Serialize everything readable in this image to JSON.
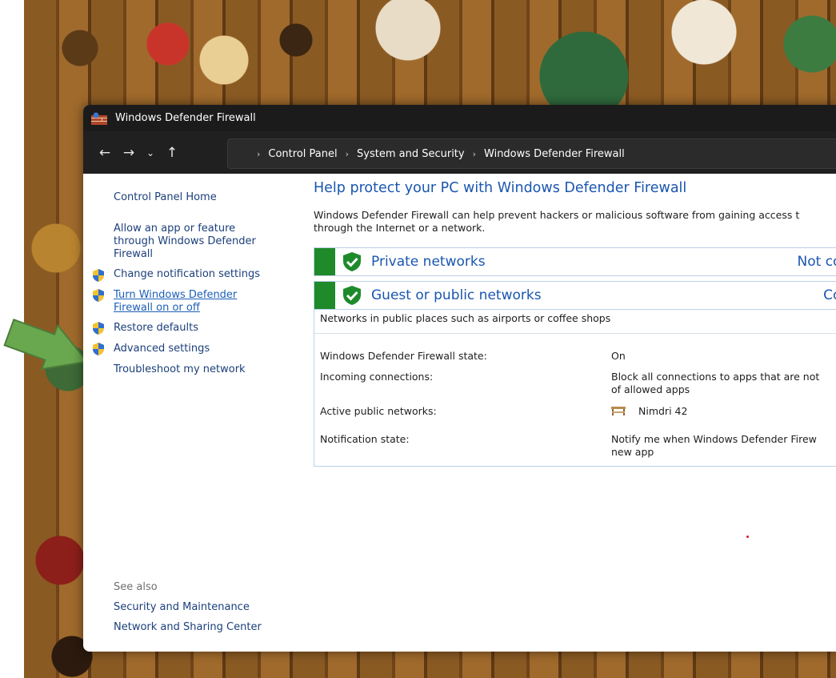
{
  "window": {
    "title": "Windows Defender Firewall",
    "address": {
      "crumbs": [
        "Control Panel",
        "System and Security",
        "Windows Defender Firewall"
      ]
    }
  },
  "sidebar": {
    "home": "Control Panel Home",
    "allow_app_line1": "Allow an app or feature",
    "allow_app_line2": "through Windows Defender",
    "allow_app_line3": "Firewall",
    "change_notifications": "Change notification settings",
    "turn_on_off_line1": "Turn Windows Defender",
    "turn_on_off_line2": "Firewall on or off",
    "restore_defaults": "Restore defaults",
    "advanced_settings": "Advanced settings",
    "troubleshoot": "Troubleshoot my network",
    "see_also_heading": "See also",
    "see_also_security": "Security and Maintenance",
    "see_also_network": "Network and Sharing Center"
  },
  "main": {
    "title": "Help protect your PC with Windows Defender Firewall",
    "intro_line1": "Windows Defender Firewall can help prevent hackers or malicious software from gaining access t",
    "intro_line2": "through the Internet or a network.",
    "private_networks": {
      "label": "Private networks",
      "status": "Not conn"
    },
    "public_networks": {
      "label": "Guest or public networks",
      "status": "Conn"
    },
    "public_details": {
      "description": "Networks in public places such as airports or coffee shops",
      "state_label": "Windows Defender Firewall state:",
      "state_value": "On",
      "incoming_label": "Incoming connections:",
      "incoming_value_line1": "Block all connections to apps that are not",
      "incoming_value_line2": "of allowed apps",
      "active_label": "Active public networks:",
      "active_value": "Nimdri  42",
      "notification_label": "Notification state:",
      "notification_value_line1": "Notify me when Windows Defender Firew",
      "notification_value_line2": "new app"
    }
  },
  "colors": {
    "link_blue": "#1a56b0",
    "title_bar": "#1b1b1b",
    "address_bar": "#202020",
    "status_green": "#1e8a2a",
    "arrow_green": "#6aa84f"
  }
}
